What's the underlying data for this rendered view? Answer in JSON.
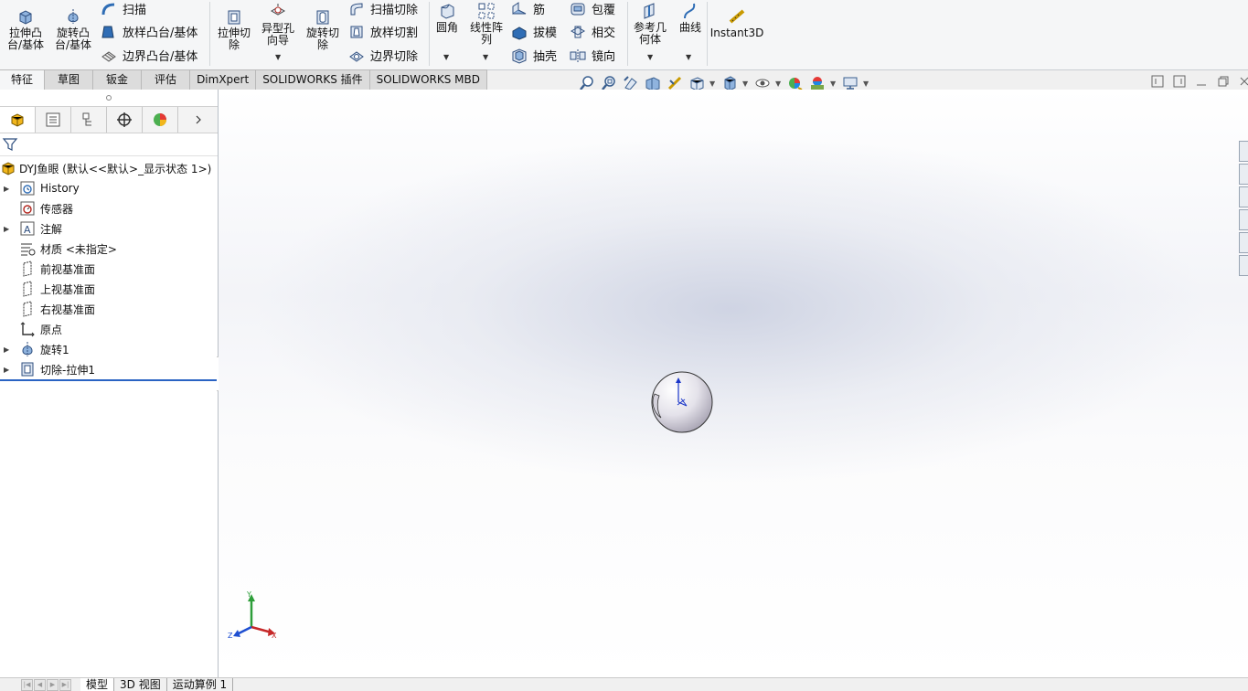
{
  "ribbon": {
    "extrude_boss": "拉伸凸\n台/基体",
    "revolve_boss": "旋转凸\n台/基体",
    "sweep": "扫描",
    "loft_boss": "放样凸台/基体",
    "boundary_boss": "边界凸台/基体",
    "extrude_cut": "拉伸切\n除",
    "hole_wizard": "异型孔\n向导",
    "revolve_cut": "旋转切\n除",
    "sweep_cut": "扫描切除",
    "loft_cut": "放样切割",
    "boundary_cut": "边界切除",
    "fillet": "圆角",
    "linear_pattern": "线性阵\n列",
    "rib": "筋",
    "draft": "拔模",
    "shell": "抽壳",
    "wrap": "包覆",
    "intersect": "相交",
    "mirror": "镜向",
    "ref_geometry": "参考几\n何体",
    "curves": "曲线",
    "instant3d": "Instant3D"
  },
  "tabs": [
    "特征",
    "草图",
    "钣金",
    "评估",
    "DimXpert",
    "SOLIDWORKS 插件",
    "SOLIDWORKS MBD"
  ],
  "tree": {
    "root": "DYJ鱼眼 (默认<<默认>_显示状态 1>)",
    "history": "History",
    "sensors": "传感器",
    "annotations": "注解",
    "material": "材质 <未指定>",
    "front_plane": "前视基准面",
    "top_plane": "上视基准面",
    "right_plane": "右视基准面",
    "origin": "原点",
    "revolve1": "旋转1",
    "cut_extrude1": "切除-拉伸1"
  },
  "triad": {
    "x": "X",
    "y": "Y",
    "z": "Z"
  },
  "bottom_tabs": [
    "模型",
    "3D 视图",
    "运动算例 1"
  ],
  "colors": {
    "accent": "#2a63c3",
    "icon_blue": "#2f6db5",
    "icon_yellow": "#f2b61c"
  }
}
